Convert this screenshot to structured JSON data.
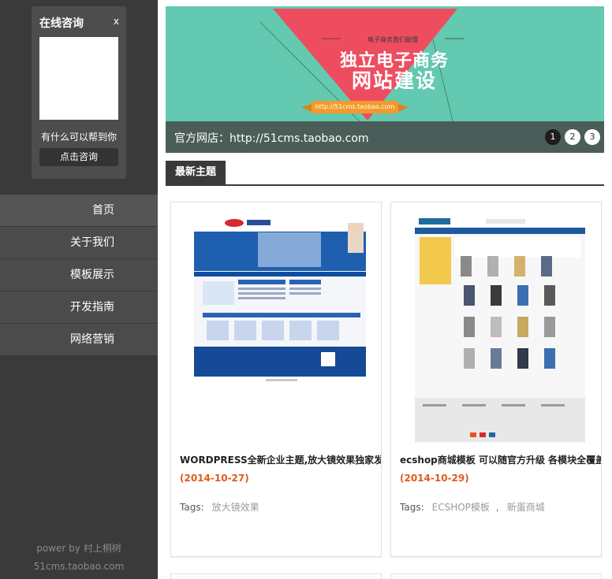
{
  "consult": {
    "title": "在线咨询",
    "close": "x",
    "help_text": "有什么可以帮到你",
    "button_label": "点击咨询"
  },
  "nav": {
    "items": [
      {
        "label": "首页"
      },
      {
        "label": "关于我们"
      },
      {
        "label": "模板展示"
      },
      {
        "label": "开发指南"
      },
      {
        "label": "网络营销"
      }
    ]
  },
  "footer": {
    "power": "power by 村上桐树",
    "site": "51cms.taobao.com"
  },
  "banner": {
    "sub_text": "电子商务我们最懂",
    "headline_1": "独立电子商务",
    "headline_2": "网站建设",
    "url_badge": "http://51cms.taobao.com",
    "caption": "官方网店：http://51cms.taobao.com",
    "dots": [
      "1",
      "2",
      "3"
    ],
    "active_dot": 1,
    "colors": {
      "background": "#63c9b1",
      "triangle": "#ee4d5f",
      "badge": "#f39a2b"
    }
  },
  "section": {
    "tab_label": "最新主题"
  },
  "cards": [
    {
      "title": "WORDPRESS全新企业主题,放大镜效果独家发售",
      "date": "(2014-10-27)",
      "tags_label": "Tags:",
      "tags": [
        "放大镜效果"
      ],
      "thumbnail": "corporate-site-screenshot"
    },
    {
      "title": "ecshop商城模板 可以随官方升级 各模块全覆盖",
      "date": "(2014-10-29)",
      "tags_label": "Tags:",
      "tags": [
        "ECSHOP模板",
        "新蛋商城"
      ],
      "thumbnail": "ecshop-store-screenshot"
    }
  ],
  "colors": {
    "sidebar": "#3a3a3a",
    "nav_item": "#4b4b4b",
    "date": "#e05a1a",
    "tag": "#9a9a9a"
  }
}
